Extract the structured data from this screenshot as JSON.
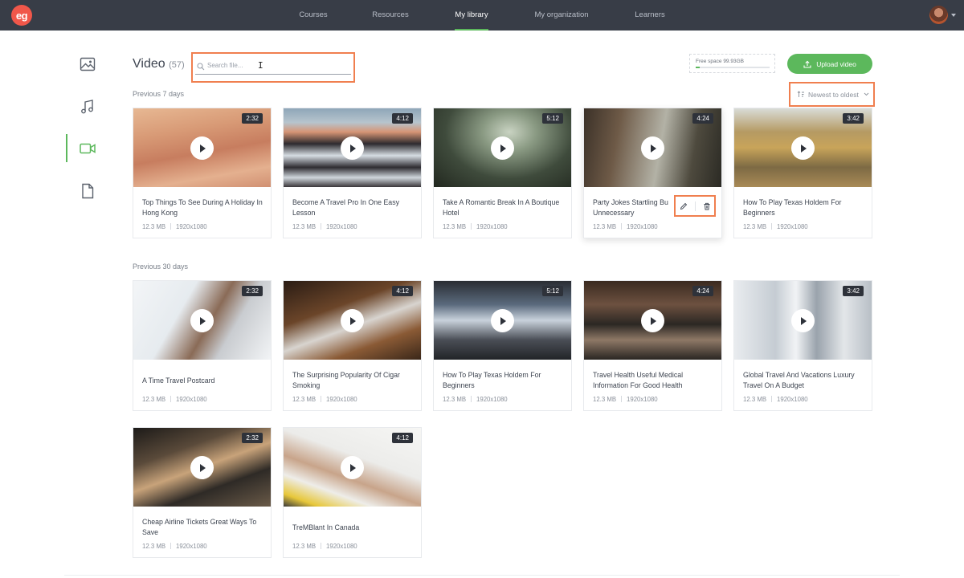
{
  "app": {
    "logo_text": "eg"
  },
  "nav": {
    "items": [
      {
        "label": "Courses",
        "active": false
      },
      {
        "label": "Resources",
        "active": false
      },
      {
        "label": "My library",
        "active": true
      },
      {
        "label": "My organization",
        "active": false
      },
      {
        "label": "Learners",
        "active": false
      }
    ]
  },
  "sidebar": {
    "items": [
      {
        "icon": "image-icon",
        "active": false
      },
      {
        "icon": "music-icon",
        "active": false
      },
      {
        "icon": "video-icon",
        "active": true
      },
      {
        "icon": "file-icon",
        "active": false
      }
    ]
  },
  "header": {
    "title": "Video",
    "count": "(57)",
    "search_placeholder": "Search file...",
    "free_space_label": "Free space 99.93GB",
    "free_space_used_fraction": 0.05,
    "upload_label": "Upload video",
    "sort_label": "Newest to oldest"
  },
  "colors": {
    "accent": "#5cb85c",
    "highlight": "#f07f4f",
    "nav_bg": "#383d47"
  },
  "sections": [
    {
      "label": "Previous 7 days",
      "cards": [
        {
          "title": "Top Things To See During A Holiday In Hong Kong",
          "duration": "2:32",
          "size": "12.3 MB",
          "resolution": "1920x1080"
        },
        {
          "title": "Become A Travel Pro In One Easy Lesson",
          "duration": "4:12",
          "size": "12.3 MB",
          "resolution": "1920x1080"
        },
        {
          "title": "Take A Romantic Break In A Boutique Hotel",
          "duration": "5:12",
          "size": "12.3 MB",
          "resolution": "1920x1080"
        },
        {
          "title": "Party Jokes Startling Bu Unnecessary",
          "duration": "4:24",
          "size": "12.3 MB",
          "resolution": "1920x1080"
        },
        {
          "title": "How To Play Texas Holdem For Beginners",
          "duration": "3:42",
          "size": "12.3 MB",
          "resolution": "1920x1080"
        }
      ]
    },
    {
      "label": "Previous 30 days",
      "cards": [
        {
          "title": "A Time Travel Postcard",
          "duration": "2:32",
          "size": "12.3 MB",
          "resolution": "1920x1080"
        },
        {
          "title": "The Surprising Popularity Of Cigar Smoking",
          "duration": "4:12",
          "size": "12.3 MB",
          "resolution": "1920x1080"
        },
        {
          "title": "How To Play Texas Holdem For Beginners",
          "duration": "5:12",
          "size": "12.3 MB",
          "resolution": "1920x1080"
        },
        {
          "title": "Travel Health Useful Medical Information For Good Health",
          "duration": "4:24",
          "size": "12.3 MB",
          "resolution": "1920x1080"
        },
        {
          "title": "Global Travel And Vacations Luxury Travel On A Budget",
          "duration": "3:42",
          "size": "12.3 MB",
          "resolution": "1920x1080"
        },
        {
          "title": "Cheap Airline Tickets Great Ways To Save",
          "duration": "2:32",
          "size": "12.3 MB",
          "resolution": "1920x1080"
        },
        {
          "title": "TreMBlant In Canada",
          "duration": "4:12",
          "size": "12.3 MB",
          "resolution": "1920x1080"
        }
      ]
    }
  ]
}
